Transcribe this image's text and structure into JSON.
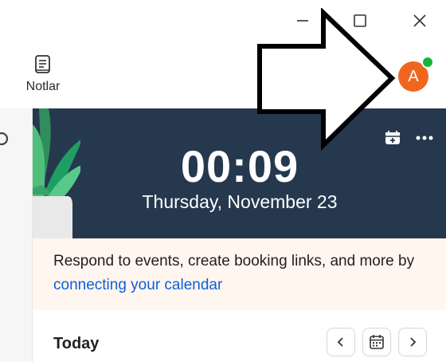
{
  "toolbar": {
    "notes_label": "Notlar",
    "avatar_initial": "A"
  },
  "clock": {
    "time": "00:09",
    "date": "Thursday, November 23"
  },
  "banner": {
    "text": "Respond to events, create booking links, and more by ",
    "link": "connecting your calendar"
  },
  "agenda": {
    "today_label": "Today"
  },
  "icons": {
    "minimize": "minimize-icon",
    "maximize": "maximize-icon",
    "close": "close-icon",
    "notes": "notes-icon",
    "bell": "bell-icon",
    "calendar_add": "calendar-add-icon",
    "more": "more-icon",
    "chevron_left": "chevron-left-icon",
    "calendar": "calendar-icon",
    "chevron_right": "chevron-right-icon",
    "arrow": "arrow-icon"
  },
  "colors": {
    "hero_bg": "#26384e",
    "avatar": "#f0661f",
    "presence": "#19b43c",
    "link": "#0e5fd8",
    "banner_bg": "#fff6f0",
    "info": "#0e72ed"
  }
}
